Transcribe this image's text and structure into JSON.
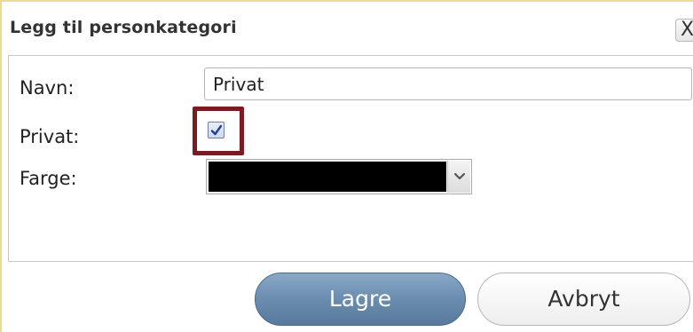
{
  "dialog": {
    "title": "Legg til personkategori",
    "close_label": "X"
  },
  "form": {
    "name_label": "Navn:",
    "name_value": "Privat",
    "private_label": "Privat:",
    "private_checked": true,
    "color_label": "Farge:",
    "color_value": "#000000"
  },
  "buttons": {
    "save_label": "Lagre",
    "cancel_label": "Avbryt"
  },
  "colors": {
    "highlight_border": "#7b1c20",
    "save_button": "#6d8fb1",
    "dialog_border": "#e7dd94"
  },
  "icons": {
    "close": "close-icon",
    "checkmark": "checkmark-icon",
    "dropdown": "chevron-down-icon"
  }
}
